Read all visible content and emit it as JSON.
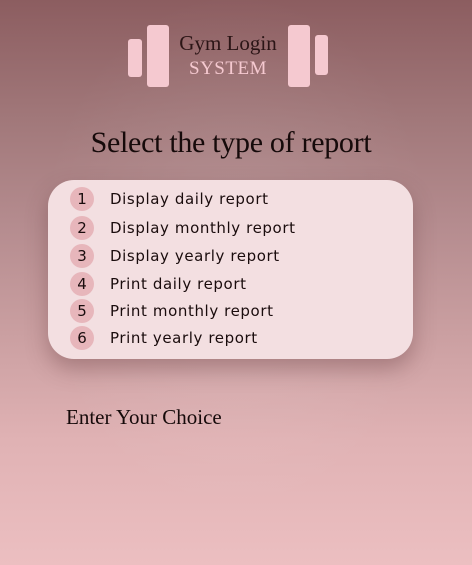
{
  "logo": {
    "title": "Gym Login",
    "subtitle": "SYSTEM"
  },
  "heading": "Select the type of report",
  "menu": {
    "items": [
      {
        "number": "1",
        "label": "Display daily report"
      },
      {
        "number": "2",
        "label": "Display monthly report"
      },
      {
        "number": "3",
        "label": "Display yearly report"
      },
      {
        "number": "4",
        "label": "Print daily report"
      },
      {
        "number": "5",
        "label": "Print monthly report"
      },
      {
        "number": "6",
        "label": "Print yearly report"
      }
    ]
  },
  "prompt": "Enter Your Choice",
  "colors": {
    "accent": "#f5c9d0",
    "card": "#f3dfe1",
    "number_badge": "#e7b6bb"
  }
}
